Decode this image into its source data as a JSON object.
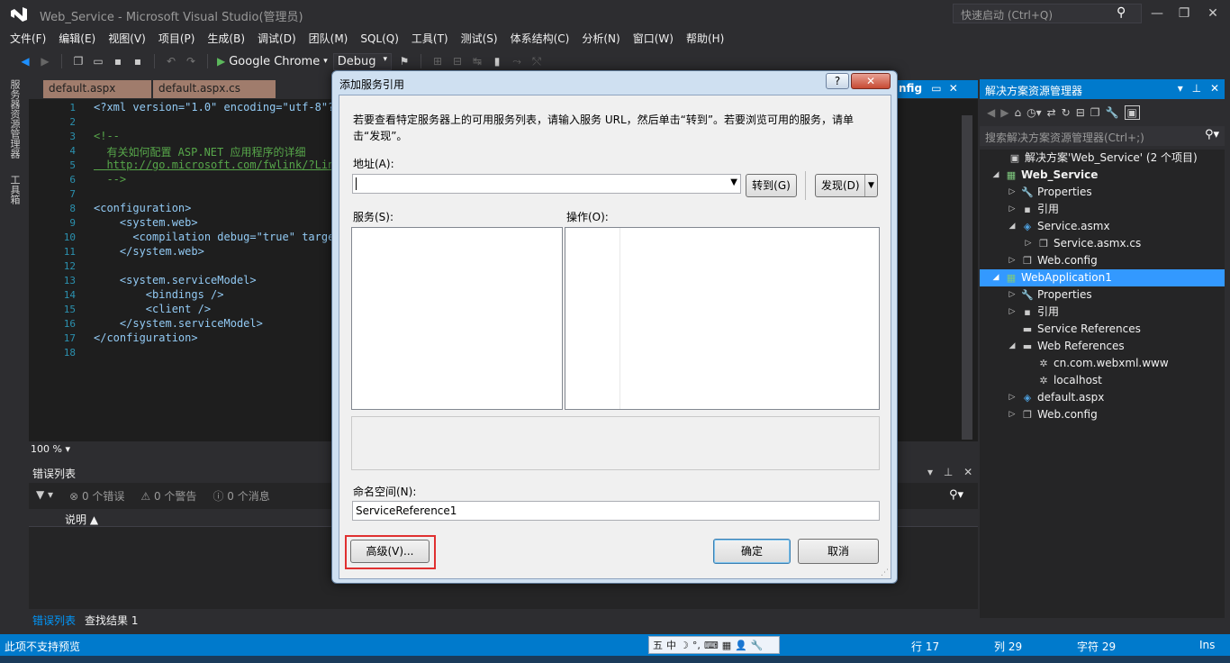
{
  "app": {
    "title": "Web_Service - Microsoft Visual Studio(管理员)",
    "quick_launch_placeholder": "快速启动 (Ctrl+Q)"
  },
  "window_controls": {
    "minimize": "—",
    "restore": "❐",
    "close": "✕"
  },
  "menu": [
    "文件(F)",
    "编辑(E)",
    "视图(V)",
    "项目(P)",
    "生成(B)",
    "调试(D)",
    "团队(M)",
    "SQL(Q)",
    "工具(T)",
    "测试(S)",
    "体系结构(C)",
    "分析(N)",
    "窗口(W)",
    "帮助(H)"
  ],
  "toolbar": {
    "run_target": "Google Chrome",
    "configuration": "Debug"
  },
  "left_strip": {
    "server_explorer": "服务器资源管理器",
    "toolbox": "工具箱"
  },
  "doc_tabs": [
    "default.aspx",
    "default.aspx.cs"
  ],
  "config_tab": "nfig",
  "editor": {
    "line_numbers": [
      "1",
      "2",
      "3",
      "4",
      "5",
      "6",
      "7",
      "8",
      "9",
      "10",
      "11",
      "12",
      "13",
      "14",
      "15",
      "16",
      "17",
      "18"
    ],
    "lines": [
      "<?xml version=\"1.0\" encoding=\"utf-8\"?",
      "",
      "<!--",
      "  有关如何配置 ASP.NET 应用程序的详细",
      "  http://go.microsoft.com/fwlink/?Lin",
      "  -->",
      "",
      "<configuration>",
      "    <system.web>",
      "      <compilation debug=\"true\" target",
      "    </system.web>",
      "",
      "    <system.serviceModel>",
      "        <bindings />",
      "        <client />",
      "    </system.serviceModel>",
      "</configuration>",
      ""
    ],
    "zoom": "100 %"
  },
  "error_list": {
    "title": "错误列表",
    "errors": "0 个错误",
    "warnings": "0 个警告",
    "messages": "0 个消息",
    "column_description": "说明"
  },
  "bottom_tabs": [
    "错误列表",
    "查找结果 1"
  ],
  "solution_explorer": {
    "title": "解决方案资源管理器",
    "search_placeholder": "搜索解决方案资源管理器(Ctrl+;)",
    "tree": [
      {
        "label": "解决方案'Web_Service' (2 个项目)",
        "icon": "solution-icon",
        "glyph": "▣"
      },
      {
        "label": "Web_Service",
        "icon": "web-project-icon",
        "glyph": "▦",
        "bold": true
      },
      {
        "label": "Properties",
        "icon": "wrench-icon",
        "glyph": "🔧"
      },
      {
        "label": "引用",
        "icon": "references-icon",
        "glyph": "▪"
      },
      {
        "label": "Service.asmx",
        "icon": "service-file-icon",
        "glyph": "◈"
      },
      {
        "label": "Service.asmx.cs",
        "icon": "csharp-file-icon",
        "glyph": "❐"
      },
      {
        "label": "Web.config",
        "icon": "config-file-icon",
        "glyph": "❐"
      },
      {
        "label": "WebApplication1",
        "icon": "web-project-icon",
        "glyph": "▦"
      },
      {
        "label": "Properties",
        "icon": "wrench-icon",
        "glyph": "🔧"
      },
      {
        "label": "引用",
        "icon": "references-icon",
        "glyph": "▪"
      },
      {
        "label": "Service References",
        "icon": "folder-icon",
        "glyph": "▬"
      },
      {
        "label": "Web References",
        "icon": "folder-icon",
        "glyph": "▬"
      },
      {
        "label": "cn.com.webxml.www",
        "icon": "web-reference-icon",
        "glyph": "✲"
      },
      {
        "label": "localhost",
        "icon": "web-reference-icon",
        "glyph": "✲"
      },
      {
        "label": "default.aspx",
        "icon": "aspx-file-icon",
        "glyph": "◈"
      },
      {
        "label": "Web.config",
        "icon": "config-file-icon",
        "glyph": "❐"
      }
    ]
  },
  "status_bar": {
    "message": "此项不支持预览",
    "line": "行 17",
    "col": "列 29",
    "char": "字符 29",
    "mode": "Ins"
  },
  "ime": {
    "items": [
      "五",
      "中",
      "☽",
      "°,",
      "⌨",
      "▦",
      "👤",
      "🔧"
    ]
  },
  "dialog": {
    "title": "添加服务引用",
    "help": "?",
    "close": "✕",
    "instructions": "若要查看特定服务器上的可用服务列表，请输入服务 URL，然后单击“转到”。若要浏览可用的服务，请单击“发现”。",
    "address_label": "地址(A):",
    "address_value": "",
    "go_button": "转到(G)",
    "discover_button": "发现(D)",
    "services_label": "服务(S):",
    "operations_label": "操作(O):",
    "namespace_label": "命名空间(N):",
    "namespace_value": "ServiceReference1",
    "advanced_button": "高级(V)...",
    "ok_button": "确定",
    "cancel_button": "取消"
  }
}
